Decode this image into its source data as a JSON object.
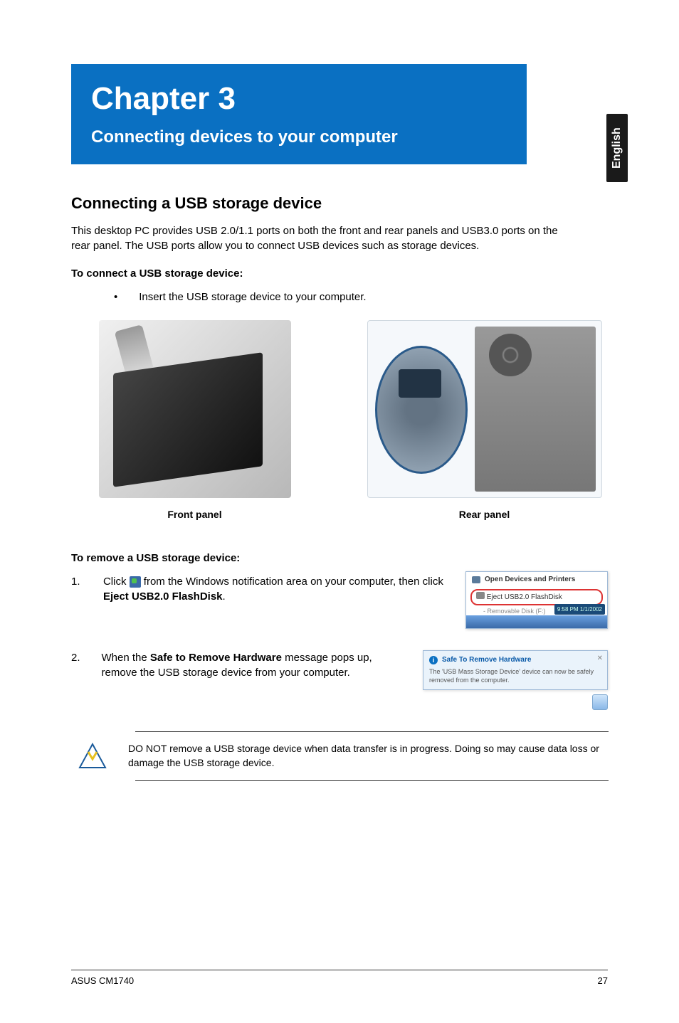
{
  "language_tab": "English",
  "chapter": {
    "title": "Chapter 3",
    "subtitle": "Connecting devices to your computer"
  },
  "section": {
    "title": "Connecting a USB storage device",
    "intro": "This desktop PC provides USB 2.0/1.1 ports on both the front and rear panels and USB3.0 ports on the rear panel. The USB ports allow you to connect USB devices such as storage devices."
  },
  "connect": {
    "heading": "To connect a USB storage device:",
    "bullet": "Insert the USB storage device to your computer."
  },
  "captions": {
    "front": "Front panel",
    "rear": "Rear panel"
  },
  "remove": {
    "heading": "To remove a USB storage device:",
    "step1_num": "1.",
    "step1_a": "Click ",
    "step1_b": " from the Windows notification area on your computer, then click ",
    "step1_bold": "Eject USB2.0 FlashDisk",
    "step1_c": ".",
    "step2_num": "2.",
    "step2_a": "When the ",
    "step2_bold": "Safe to Remove Hardware",
    "step2_b": " message pops up, remove the USB storage device from your computer."
  },
  "eject_popup": {
    "open_devices": "Open Devices and Printers",
    "eject_item": "Eject USB2.0 FlashDisk",
    "removable": "- Removable Disk (F:)",
    "clock": "9:58 PM\n1/1/2002"
  },
  "notif": {
    "title": "Safe To Remove Hardware",
    "body": "The 'USB Mass Storage Device' device can now be safely removed from the computer."
  },
  "warning": "DO NOT remove a USB storage device when data transfer is in progress. Doing so may cause data loss or damage the USB storage device.",
  "footer": {
    "model": "ASUS CM1740",
    "page": "27"
  }
}
